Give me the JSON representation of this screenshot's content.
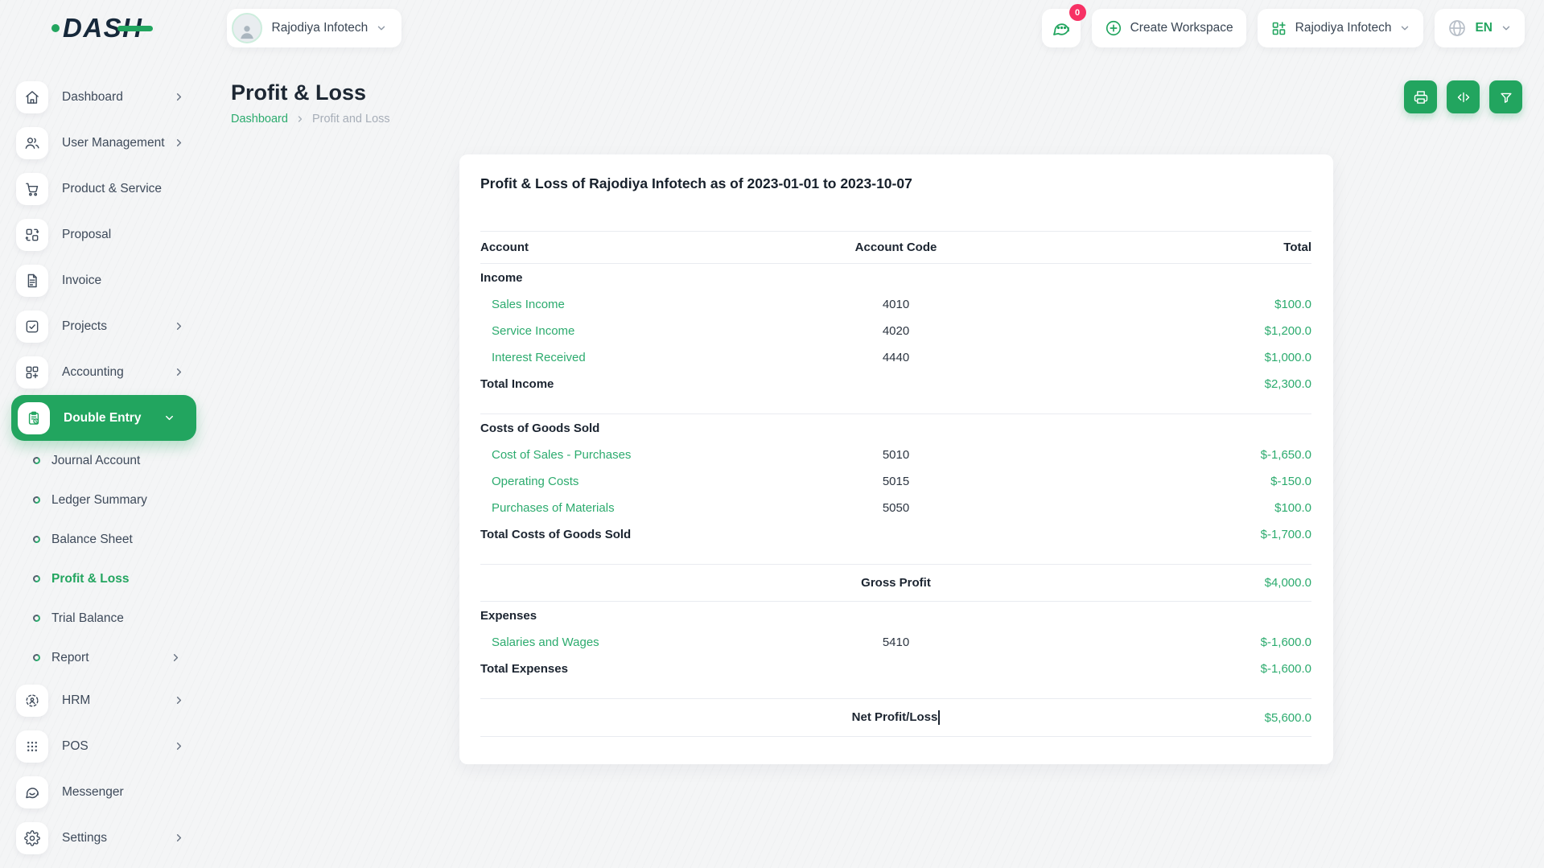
{
  "brand": {
    "logo_text": "DASH"
  },
  "colors": {
    "primary": "#22a55f",
    "link_green": "#2cab6e",
    "badge_pink": "#f73164"
  },
  "topbar": {
    "workspace_selector": {
      "label": "Rajodiya Infotech",
      "icon": "avatar"
    },
    "messages": {
      "icon": "chat-bubble",
      "badge": "0"
    },
    "create_workspace_label": "Create Workspace",
    "company_selector": {
      "label": "Rajodiya Infotech",
      "icon": "grid-plus"
    },
    "language_selector": {
      "label": "EN",
      "icon": "globe"
    }
  },
  "sidebar": {
    "items": [
      {
        "label": "Dashboard",
        "icon": "home",
        "chevron": "right"
      },
      {
        "label": "User Management",
        "icon": "users",
        "chevron": "right"
      },
      {
        "label": "Product & Service",
        "icon": "cart"
      },
      {
        "label": "Proposal",
        "icon": "proposal"
      },
      {
        "label": "Invoice",
        "icon": "invoice"
      },
      {
        "label": "Projects",
        "icon": "check-square",
        "chevron": "right"
      },
      {
        "label": "Accounting",
        "icon": "grid-plus",
        "chevron": "right"
      },
      {
        "label": "Double Entry",
        "icon": "clipboard-clock",
        "chevron": "down",
        "active": true
      },
      {
        "label": "Journal Account",
        "sub": true
      },
      {
        "label": "Ledger Summary",
        "sub": true
      },
      {
        "label": "Balance Sheet",
        "sub": true
      },
      {
        "label": "Profit & Loss",
        "sub": true,
        "active": true
      },
      {
        "label": "Trial Balance",
        "sub": true
      },
      {
        "label": "Report",
        "sub": true,
        "chevron": "right"
      },
      {
        "label": "HRM",
        "icon": "hrm",
        "chevron": "right"
      },
      {
        "label": "POS",
        "icon": "pos",
        "chevron": "right"
      },
      {
        "label": "Messenger",
        "icon": "messenger"
      },
      {
        "label": "Settings",
        "icon": "settings",
        "chevron": "right"
      }
    ]
  },
  "page": {
    "title": "Profit & Loss",
    "breadcrumb": {
      "link": "Dashboard",
      "current": "Profit and Loss"
    },
    "actions": [
      {
        "name": "print-button",
        "icon": "printer"
      },
      {
        "name": "toggle-columns-button",
        "icon": "code"
      },
      {
        "name": "filter-button",
        "icon": "filter"
      }
    ]
  },
  "report": {
    "title": "Profit & Loss of Rajodiya Infotech as of 2023-01-01 to 2023-10-07",
    "columns": [
      "Account",
      "Account Code",
      "Total"
    ],
    "rows": [
      {
        "type": "section",
        "label": "Income"
      },
      {
        "type": "item",
        "label": "Sales Income",
        "code": "4010",
        "total": "$100.0"
      },
      {
        "type": "item",
        "label": "Service Income",
        "code": "4020",
        "total": "$1,200.0"
      },
      {
        "type": "item",
        "label": "Interest Received",
        "code": "4440",
        "total": "$1,000.0"
      },
      {
        "type": "total",
        "label": "Total Income",
        "total": "$2,300.0"
      },
      {
        "type": "spacer"
      },
      {
        "type": "section",
        "label": "Costs of Goods Sold"
      },
      {
        "type": "item",
        "label": "Cost of Sales - Purchases",
        "code": "5010",
        "total": "$-1,650.0"
      },
      {
        "type": "item",
        "label": "Operating Costs",
        "code": "5015",
        "total": "$-150.0"
      },
      {
        "type": "item",
        "label": "Purchases of Materials",
        "code": "5050",
        "total": "$100.0"
      },
      {
        "type": "total",
        "label": "Total Costs of Goods Sold",
        "total": "$-1,700.0"
      },
      {
        "type": "spacer"
      },
      {
        "type": "center",
        "label": "Gross Profit",
        "total": "$4,000.0"
      },
      {
        "type": "section",
        "label": "Expenses"
      },
      {
        "type": "item",
        "label": "Salaries and Wages",
        "code": "5410",
        "total": "$-1,600.0"
      },
      {
        "type": "total",
        "label": "Total Expenses",
        "total": "$-1,600.0"
      },
      {
        "type": "spacer"
      },
      {
        "type": "center",
        "label": "Net Profit/Loss",
        "total": "$5,600.0",
        "caret": true
      }
    ]
  }
}
